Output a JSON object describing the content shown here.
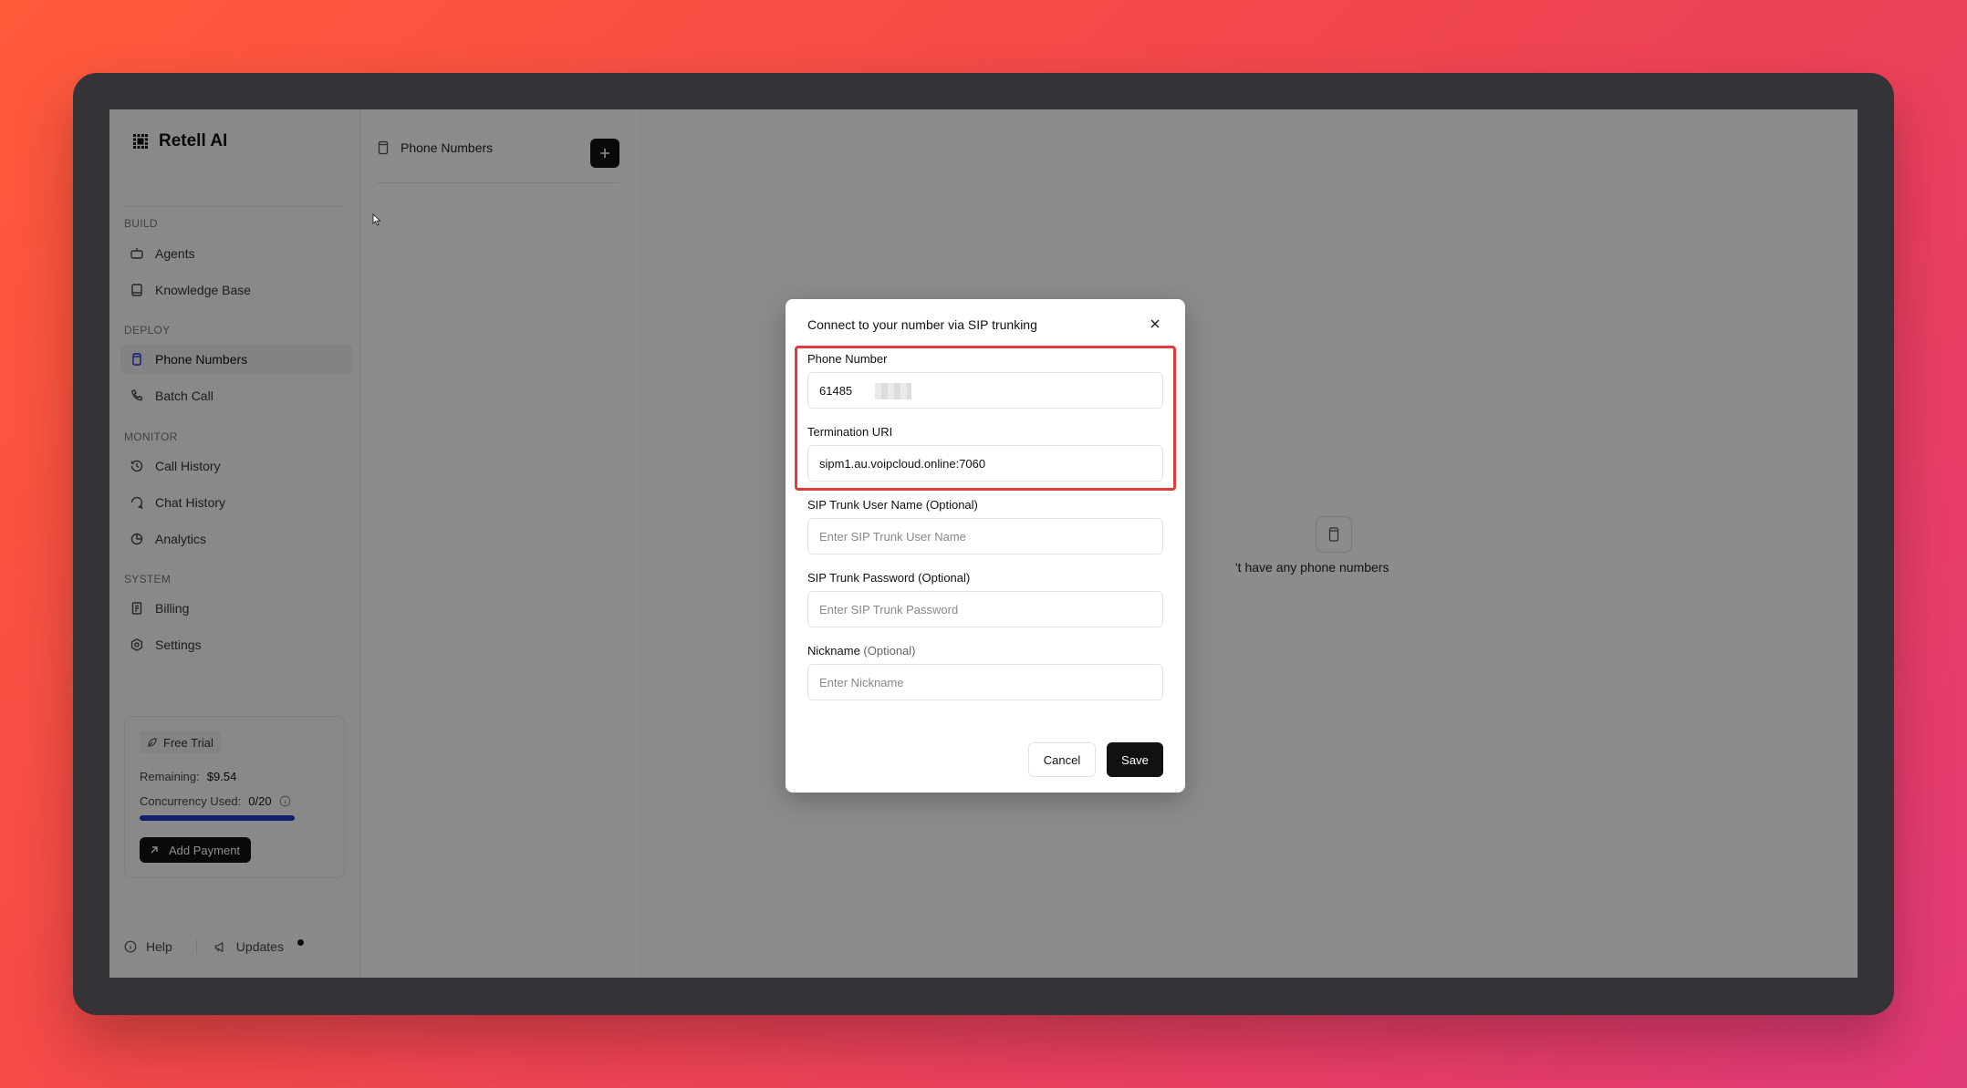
{
  "app": {
    "name": "Retell AI"
  },
  "sidebar": {
    "sections": [
      {
        "label": "BUILD",
        "items": [
          {
            "label": "Agents",
            "icon": "robot-icon"
          },
          {
            "label": "Knowledge Base",
            "icon": "book-icon"
          }
        ]
      },
      {
        "label": "DEPLOY",
        "items": [
          {
            "label": "Phone Numbers",
            "icon": "phone-device-icon",
            "active": true
          },
          {
            "label": "Batch Call",
            "icon": "phone-icon"
          }
        ]
      },
      {
        "label": "MONITOR",
        "items": [
          {
            "label": "Call History",
            "icon": "history-icon"
          },
          {
            "label": "Chat History",
            "icon": "chat-icon"
          },
          {
            "label": "Analytics",
            "icon": "pie-chart-icon"
          }
        ]
      },
      {
        "label": "SYSTEM",
        "items": [
          {
            "label": "Billing",
            "icon": "receipt-icon"
          },
          {
            "label": "Settings",
            "icon": "gear-icon"
          }
        ]
      }
    ],
    "trial": {
      "badge": "Free Trial",
      "remaining_label": "Remaining:",
      "remaining_value": "$9.54",
      "concurrency_label": "Concurrency Used:",
      "concurrency_value": "0/20",
      "add_payment": "Add Payment"
    },
    "bottom": {
      "help": "Help",
      "updates": "Updates"
    }
  },
  "list_panel": {
    "title": "Phone Numbers"
  },
  "main": {
    "empty_text": "'t have any phone numbers"
  },
  "modal": {
    "title": "Connect to your number via SIP trunking",
    "phone_label": "Phone Number",
    "phone_value": "61485",
    "termination_label": "Termination URI",
    "termination_value": "sipm1.au.voipcloud.online:7060",
    "sip_user_label": "SIP Trunk User Name (Optional)",
    "sip_user_placeholder": "Enter SIP Trunk User Name",
    "sip_pass_label": "SIP Trunk Password (Optional)",
    "sip_pass_placeholder": "Enter SIP Trunk Password",
    "nickname_label": "Nickname",
    "nickname_optional": "(Optional)",
    "nickname_placeholder": "Enter Nickname",
    "cancel": "Cancel",
    "save": "Save"
  },
  "colors": {
    "accent_bar": "#2137c8",
    "highlight": "#e03c3c"
  }
}
